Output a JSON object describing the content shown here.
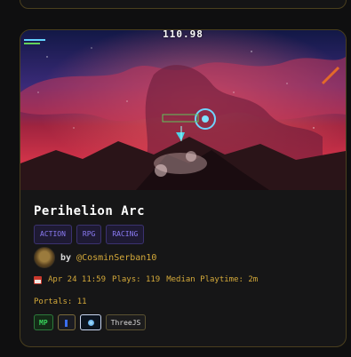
{
  "game": {
    "score": "110.98",
    "title": "Perihelion Arc",
    "genres": [
      "ACTION",
      "RPG",
      "RACING"
    ],
    "author_prefix": "by",
    "author": "@CosminSerban10",
    "date": "Apr 24 11:59",
    "plays": "Plays: 119",
    "median_playtime": "Median Playtime: 2m",
    "portals": "Portals: 11",
    "badges": {
      "mp": "MP",
      "engine": "ThreeJS"
    }
  },
  "colors": {
    "accent_gold": "#d4a93a",
    "tag_purple": "#8b7bf4",
    "mp_green": "#37d25a",
    "card_border": "#4a3f1e"
  },
  "icons": {
    "date": "calendar-icon",
    "avatar": "author-avatar"
  }
}
